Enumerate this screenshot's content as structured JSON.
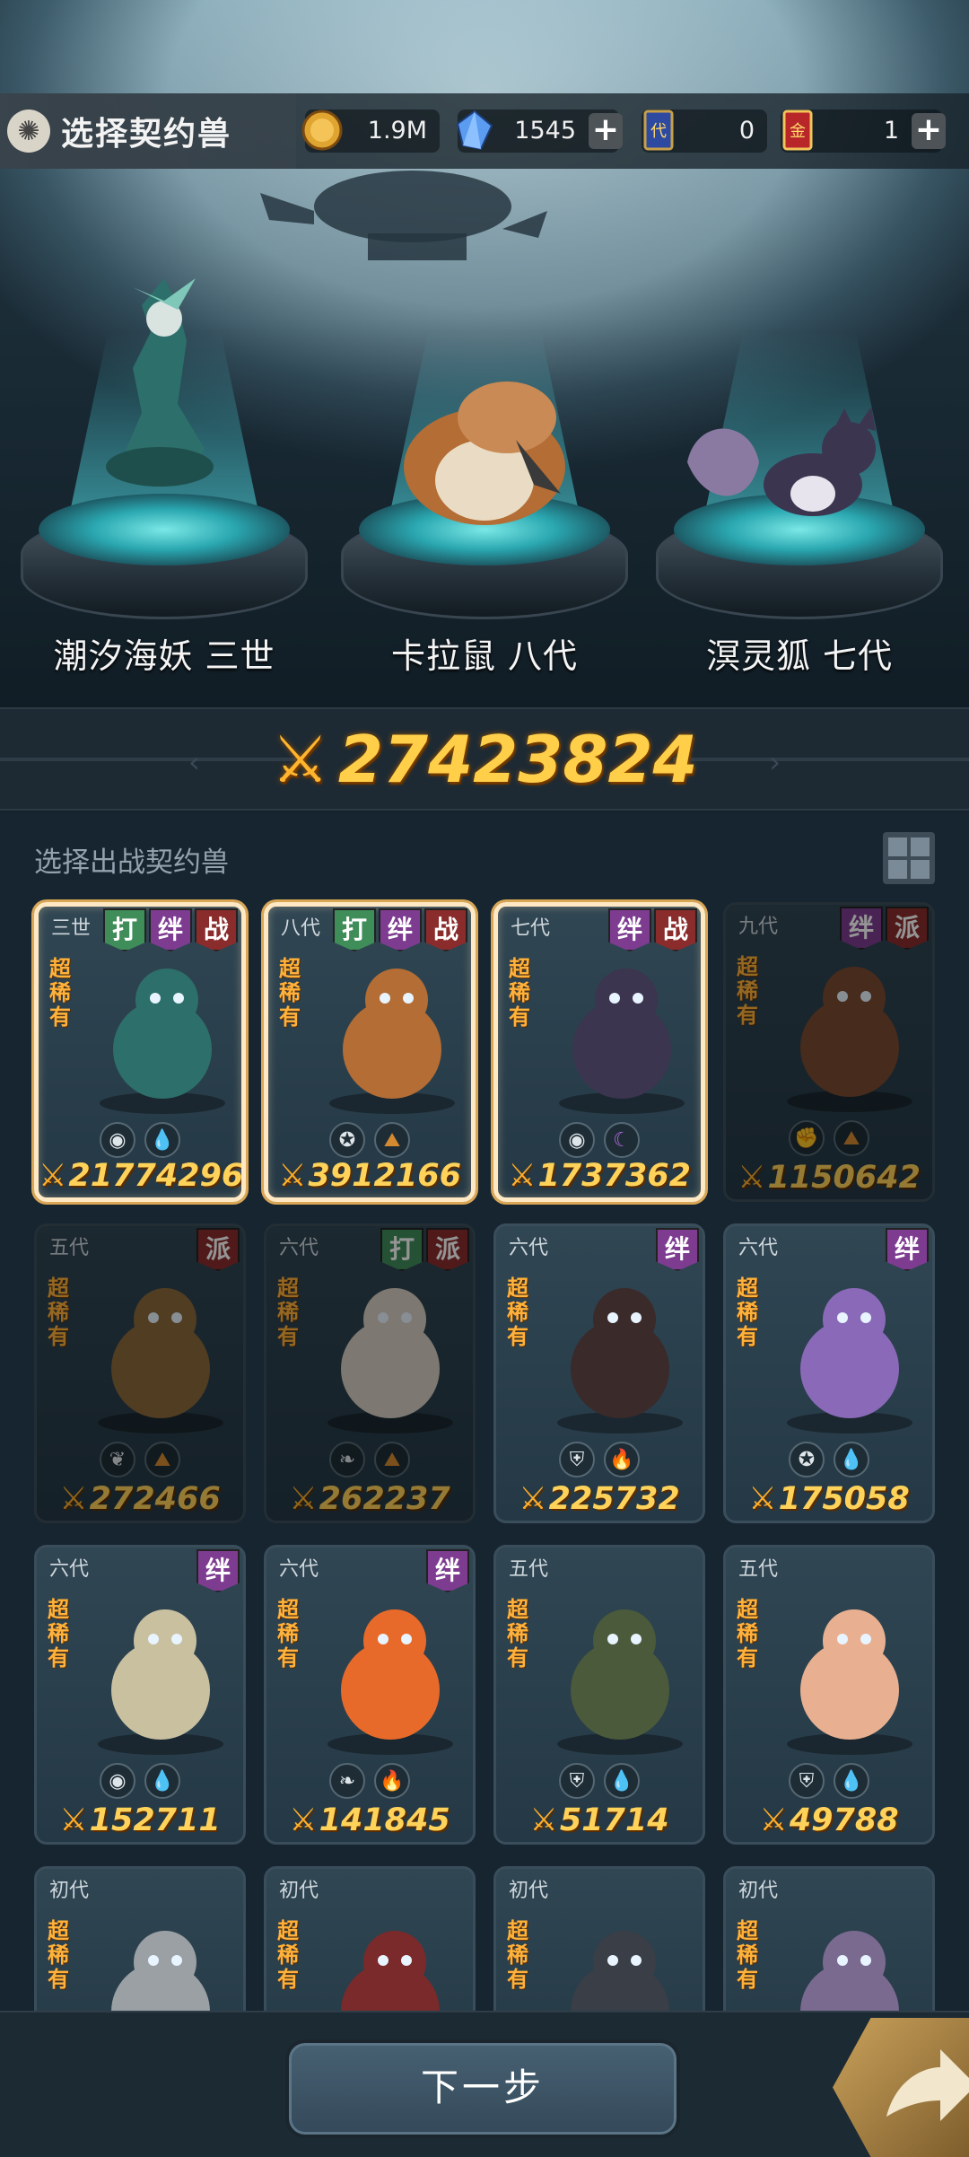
{
  "header": {
    "title": "选择契约兽",
    "resources": [
      {
        "name": "gold-coin",
        "value": "1.9M",
        "plus": false
      },
      {
        "name": "crystal",
        "value": "1545",
        "plus": true
      },
      {
        "name": "generation-ticket",
        "value": "0",
        "plus": false
      },
      {
        "name": "gold-ticket",
        "value": "1",
        "plus": true
      }
    ]
  },
  "stage": {
    "pets": [
      {
        "name": "潮汐海妖 三世"
      },
      {
        "name": "卡拉鼠 八代"
      },
      {
        "name": "溟灵狐 七代"
      }
    ]
  },
  "total_power": "27423824",
  "section": {
    "title": "选择出战契约兽"
  },
  "rarity_label": "超稀有",
  "tag_labels": {
    "da": "打",
    "ban": "绊",
    "zhan": "战",
    "pai": "派"
  },
  "colors": {
    "power": "#ffd25a",
    "selected_border": "#ffe9c4",
    "accent_teal": "#2aa7b0"
  },
  "cards": [
    {
      "gen": "三世",
      "tags": [
        "da",
        "ban",
        "zhan"
      ],
      "elements": [
        "eye-icon",
        "water-drop-icon"
      ],
      "power": "21774296",
      "selected": true
    },
    {
      "gen": "八代",
      "tags": [
        "da",
        "ban",
        "zhan"
      ],
      "elements": [
        "gear-icon",
        "earth-icon"
      ],
      "power": "3912166",
      "selected": true
    },
    {
      "gen": "七代",
      "tags": [
        "ban",
        "zhan"
      ],
      "elements": [
        "eye-icon",
        "moon-icon"
      ],
      "power": "1737362",
      "selected": true
    },
    {
      "gen": "九代",
      "tags": [
        "ban",
        "pai"
      ],
      "elements": [
        "fist-icon",
        "earth-icon"
      ],
      "power": "1150642",
      "selected": false,
      "dim": true
    },
    {
      "gen": "五代",
      "tags": [
        "pai"
      ],
      "elements": [
        "leaf-icon",
        "earth-icon"
      ],
      "power": "272466",
      "dim": true
    },
    {
      "gen": "六代",
      "tags": [
        "da",
        "pai"
      ],
      "elements": [
        "sprout-icon",
        "earth-icon"
      ],
      "power": "262237",
      "dim": true
    },
    {
      "gen": "六代",
      "tags": [
        "ban"
      ],
      "elements": [
        "shield-icon",
        "fire-icon"
      ],
      "power": "225732"
    },
    {
      "gen": "六代",
      "tags": [
        "ban"
      ],
      "elements": [
        "gear-icon",
        "water-drop-icon"
      ],
      "power": "175058"
    },
    {
      "gen": "六代",
      "tags": [
        "ban"
      ],
      "elements": [
        "eye-icon",
        "water-drop-icon"
      ],
      "power": "152711"
    },
    {
      "gen": "六代",
      "tags": [
        "ban"
      ],
      "elements": [
        "sprout-icon",
        "fire-icon"
      ],
      "power": "141845"
    },
    {
      "gen": "五代",
      "tags": [],
      "elements": [
        "shield-icon",
        "water-drop-icon"
      ],
      "power": "51714"
    },
    {
      "gen": "五代",
      "tags": [],
      "elements": [
        "shield-icon",
        "water-drop-icon"
      ],
      "power": "49788"
    },
    {
      "gen": "初代",
      "tags": [],
      "elements": [],
      "power": ""
    },
    {
      "gen": "初代",
      "tags": [],
      "elements": [],
      "power": ""
    },
    {
      "gen": "初代",
      "tags": [],
      "elements": [],
      "power": ""
    },
    {
      "gen": "初代",
      "tags": [],
      "elements": [],
      "power": ""
    }
  ],
  "footer": {
    "next_label": "下一步"
  }
}
